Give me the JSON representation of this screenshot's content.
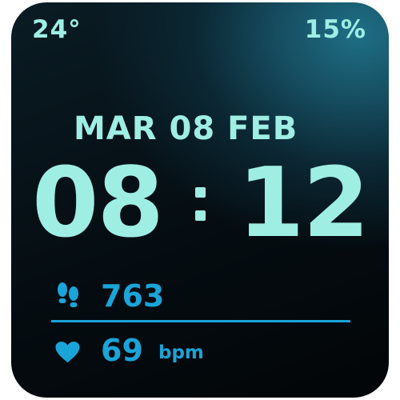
{
  "status": {
    "temperature": "24°",
    "battery": "15%"
  },
  "date": {
    "text": "MAR 08 FEB"
  },
  "time": {
    "hours": "08",
    "minutes": "12"
  },
  "steps": {
    "icon": "footprints-icon",
    "value": "763"
  },
  "heart_rate": {
    "icon": "heart-icon",
    "value": "69",
    "unit": "bpm"
  },
  "colors": {
    "primary_text": "#9eeee4",
    "accent": "#1aa4d8",
    "background": "#050d12"
  }
}
